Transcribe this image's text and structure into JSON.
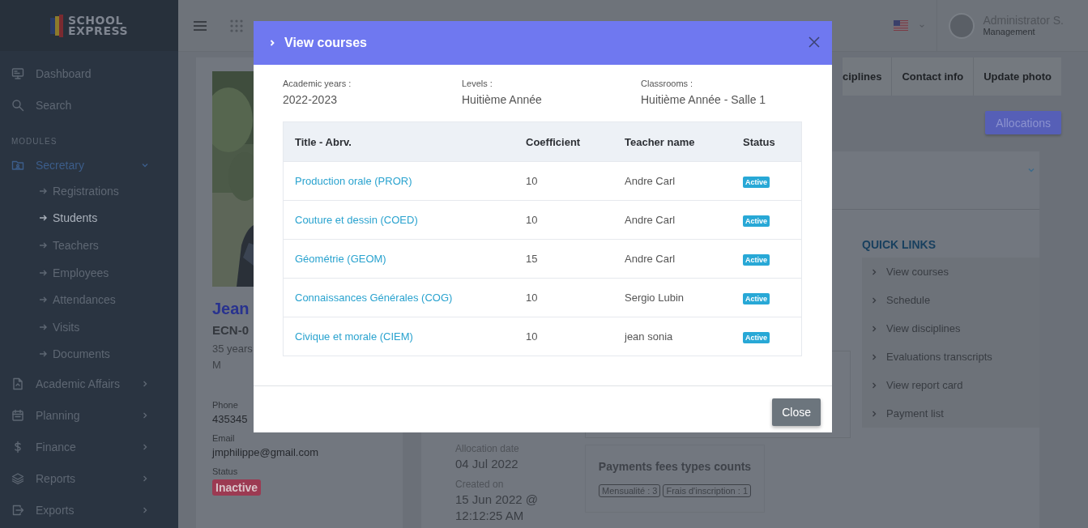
{
  "sidebar": {
    "logo": [
      "SCHOOL",
      "EXPRESS"
    ],
    "items": [
      {
        "label": "Dashboard"
      },
      {
        "label": "Search"
      }
    ],
    "section": "MODULES",
    "modules": [
      {
        "label": "Secretary",
        "selected": true,
        "expanded": true,
        "children": [
          {
            "label": "Registrations",
            "selected": false
          },
          {
            "label": "Students",
            "selected": true
          },
          {
            "label": "Teachers",
            "selected": false
          },
          {
            "label": "Employees",
            "selected": false
          },
          {
            "label": "Attendances",
            "selected": false
          },
          {
            "label": "Visits",
            "selected": false
          },
          {
            "label": "Documents",
            "selected": false
          }
        ]
      },
      {
        "label": "Academic Affairs",
        "selected": false,
        "expanded": false
      },
      {
        "label": "Planning",
        "selected": false,
        "expanded": false
      },
      {
        "label": "Finance",
        "selected": false,
        "expanded": false
      },
      {
        "label": "Reports",
        "selected": false,
        "expanded": false
      },
      {
        "label": "Exports",
        "selected": false,
        "expanded": false
      }
    ]
  },
  "topbar": {
    "user": {
      "name": "Administrator S.",
      "role": "Management"
    }
  },
  "profile": {
    "name": "Jean",
    "code": "ECN-0",
    "age": "35 years",
    "sex": "M",
    "fields": [
      {
        "label": "Phone",
        "value": "435345",
        "kind": "text"
      },
      {
        "label": "Email",
        "value": "jmphilippe@gmail.com",
        "kind": "text"
      },
      {
        "label": "Status",
        "value": "Inactive",
        "kind": "badge"
      }
    ]
  },
  "tabs": [
    {
      "label": "ciplines"
    },
    {
      "label": "Contact info"
    },
    {
      "label": "Update photo"
    }
  ],
  "allocations_button": "Allocations",
  "allocation": [
    {
      "label": "Allocation date",
      "value": "04 Jul 2022"
    },
    {
      "label": "Created on",
      "value": "15 Jun 2022 @ 12:12:25 AM"
    }
  ],
  "payments": {
    "title": "Payments fees types counts",
    "badges": [
      "Mensualité : 3",
      "Frais d'inscription : 1"
    ]
  },
  "quick_links": {
    "title": "QUICK LINKS",
    "items": [
      "View courses",
      "Schedule",
      "View disciplines",
      "Evaluations transcripts",
      "View report card",
      "Payment list"
    ]
  },
  "modal": {
    "title": "View courses",
    "info": [
      {
        "label": "Academic years :",
        "value": "2022-2023"
      },
      {
        "label": "Levels :",
        "value": "Huitième Année"
      },
      {
        "label": "Classrooms :",
        "value": "Huitième Année - Salle 1"
      }
    ],
    "table": {
      "columns": [
        "Title - Abrv.",
        "Coefficient",
        "Teacher name",
        "Status"
      ],
      "rows": [
        {
          "title": "Production orale (PROR)",
          "coefficient": "10",
          "teacher": "Andre Carl",
          "status": "Active"
        },
        {
          "title": "Couture et dessin (COED)",
          "coefficient": "10",
          "teacher": "Andre Carl",
          "status": "Active"
        },
        {
          "title": "Géométrie (GEOM)",
          "coefficient": "15",
          "teacher": "Andre Carl",
          "status": "Active"
        },
        {
          "title": "Connaissances Générales (COG)",
          "coefficient": "10",
          "teacher": "Sergio Lubin",
          "status": "Active"
        },
        {
          "title": "Civique et morale (CIEM)",
          "coefficient": "10",
          "teacher": "jean sonia",
          "status": "Active"
        }
      ]
    },
    "close_button": "Close"
  }
}
